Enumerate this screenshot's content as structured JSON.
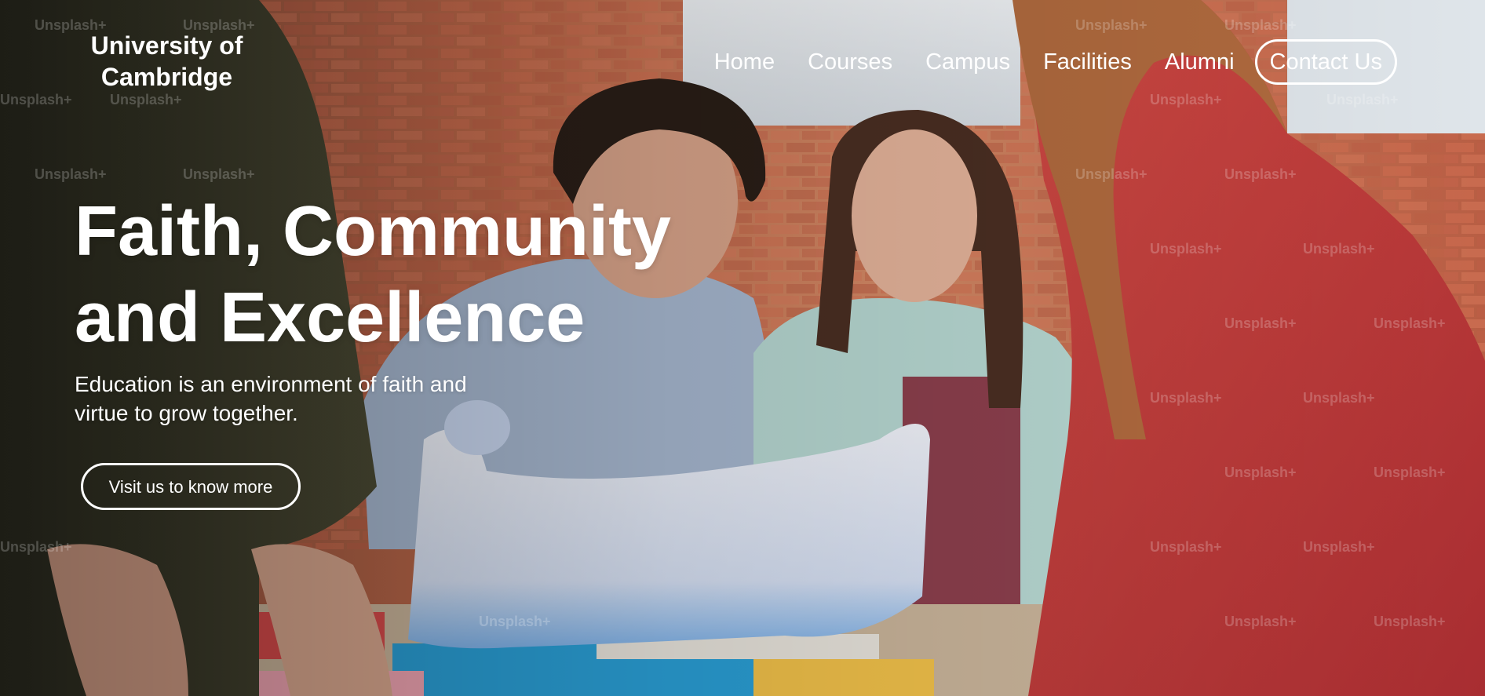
{
  "brand": {
    "line1": "University of",
    "line2": "Cambridge"
  },
  "nav": {
    "items": [
      {
        "label": "Home"
      },
      {
        "label": "Courses"
      },
      {
        "label": "Campus"
      },
      {
        "label": "Facilities"
      },
      {
        "label": "Alumni"
      }
    ],
    "contact_label": "Contact Us"
  },
  "hero": {
    "headline_line1": "Faith, Community",
    "headline_line2": "and Excellence",
    "subtitle_line1": "Education is an environment of faith and",
    "subtitle_line2": "virtue to grow together.",
    "cta_label": "Visit us to know more",
    "watermark_text": "Unsplash+"
  },
  "colors": {
    "text": "#ffffff",
    "brick": "#b5593a",
    "shirt_blue": "#a9bcd6",
    "cardigan": "#b9d9d4",
    "jacket_red": "#c0383a",
    "dark_jacket": "#3a3a2a"
  }
}
